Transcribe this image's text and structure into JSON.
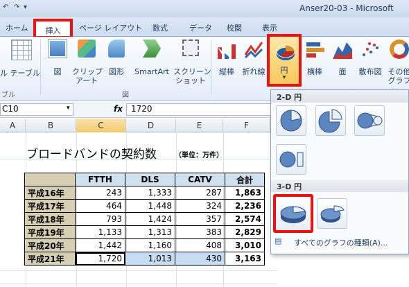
{
  "window": {
    "title": "Anser20-03 - Microsoft"
  },
  "tabs": [
    "ホーム",
    "挿入",
    "ページ レイアウト",
    "数式",
    "データ",
    "校閲",
    "表示"
  ],
  "ribbon": {
    "table_label": "ル テーブル",
    "table_group_label": "ブル",
    "picture_label": "図",
    "clipart_label": "クリップ\nアート",
    "shapes_label": "図形",
    "smartart_label": "SmartArt",
    "screenshot_label": "スクリーン\nショット",
    "illustrations_group_label": "図",
    "column_label": "縦棒",
    "line_label": "折れ線",
    "pie_label": "円",
    "bar_label": "横棒",
    "area_label": "面",
    "scatter_label": "散布図",
    "other_label": "その他\nグラフ"
  },
  "formula_bar": {
    "name_box": "C10",
    "fx": "fx",
    "value": "1720"
  },
  "columns": [
    "A",
    "B",
    "C",
    "D",
    "E",
    "F"
  ],
  "sheet": {
    "title": "ブロードバンドの契約数",
    "unit": "（単位：万件）",
    "headers": [
      "",
      "FTTH",
      "DLS",
      "CATV",
      "合計"
    ],
    "rows": [
      [
        "平成16年",
        "243",
        "1,333",
        "287",
        "1,863"
      ],
      [
        "平成17年",
        "464",
        "1,448",
        "324",
        "2,236"
      ],
      [
        "平成18年",
        "793",
        "1,424",
        "357",
        "2,574"
      ],
      [
        "平成19年",
        "1,133",
        "1,313",
        "383",
        "2,829"
      ],
      [
        "平成20年",
        "1,442",
        "1,160",
        "408",
        "3,010"
      ],
      [
        "平成21年",
        "1,720",
        "1,013",
        "430",
        "3,163"
      ]
    ]
  },
  "dropdown": {
    "section_2d": "2-D 円",
    "section_3d": "3-D 円",
    "all_charts": "すべてのグラフの種類(A)..."
  },
  "colors": {
    "highlight_red": "#ee1111",
    "ribbon_blue": "#1e395b"
  }
}
